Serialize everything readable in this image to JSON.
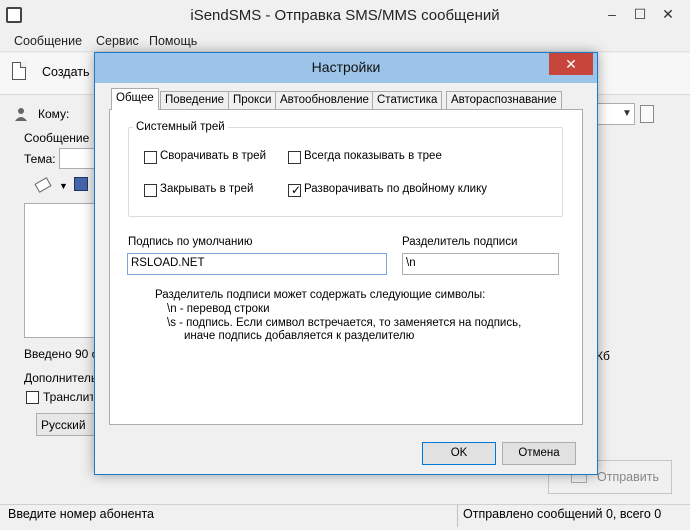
{
  "app": {
    "title": "iSendSMS - Отправка SMS/MMS сообщений",
    "window_controls": {
      "minimize": "–",
      "maximize": "☐",
      "close": "✕"
    }
  },
  "menu": [
    "Сообщение",
    "Сервис",
    "Помощь"
  ],
  "toolbar": {
    "create_label": "Создать"
  },
  "main": {
    "to_label": "Кому:",
    "message_legend": "Сообщение",
    "subject_label": "Тема:",
    "entered_label": "Введено 90 с",
    "kb_label": "Кб",
    "extra_legend": "Дополнитель",
    "translit_label": "Транслите",
    "language_value": "Русский",
    "send_label": "Отправить"
  },
  "status": {
    "left": "Введите номер абонента",
    "right": "Отправлено сообщений 0, всего 0"
  },
  "dialog": {
    "title": "Настройки",
    "close_glyph": "✕",
    "tabs": [
      "Общее",
      "Поведение",
      "Прокси",
      "Автообновление",
      "Статистика",
      "Автораспознавание"
    ],
    "active_tab": "Общее",
    "tray_group": {
      "legend": "Системный трей",
      "options": [
        {
          "label": "Сворачивать в трей",
          "checked": false
        },
        {
          "label": "Всегда показывать в трее",
          "checked": false
        },
        {
          "label": "Закрывать в трей",
          "checked": false
        },
        {
          "label": "Разворачивать по двойному клику",
          "checked": true
        }
      ]
    },
    "signature_label": "Подпись по умолчанию",
    "signature_value": "RSLOAD.NET",
    "separator_label": "Разделитель подписи",
    "separator_value": "\\n",
    "help_lines": [
      "Разделитель подписи может содержать следующие символы:",
      "\\n - перевод строки",
      "\\s - подпись. Если символ встречается, то заменяется на подпись,",
      "иначе подпись добавляется к разделителю"
    ],
    "ok_label": "OK",
    "cancel_label": "Отмена",
    "check_glyph": "✓"
  }
}
